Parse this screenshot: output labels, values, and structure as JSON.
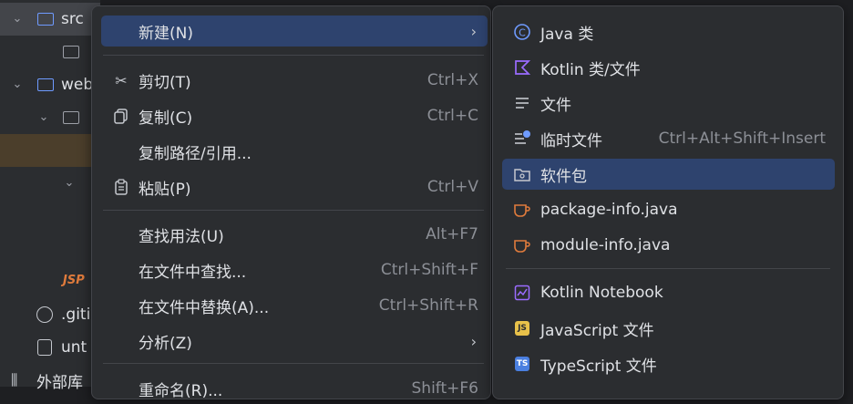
{
  "tree": {
    "items": [
      {
        "label": "src"
      },
      {
        "label": ""
      },
      {
        "label": "web"
      },
      {
        "label": ""
      },
      {
        "label": ".giti"
      },
      {
        "label": "unt"
      },
      {
        "label": "外部库"
      }
    ],
    "jsp_badge": "JSP"
  },
  "menu_main": {
    "items": [
      {
        "label": "新建(N)",
        "shortcut": "",
        "submenu": true
      },
      {
        "label": "剪切(T)",
        "shortcut": "Ctrl+X"
      },
      {
        "label": "复制(C)",
        "shortcut": "Ctrl+C"
      },
      {
        "label": "复制路径/引用...",
        "shortcut": ""
      },
      {
        "label": "粘贴(P)",
        "shortcut": "Ctrl+V"
      },
      {
        "label": "查找用法(U)",
        "shortcut": "Alt+F7"
      },
      {
        "label": "在文件中查找...",
        "shortcut": "Ctrl+Shift+F"
      },
      {
        "label": "在文件中替换(A)...",
        "shortcut": "Ctrl+Shift+R"
      },
      {
        "label": "分析(Z)",
        "shortcut": "",
        "submenu": true
      },
      {
        "label": "重命名(R)...",
        "shortcut": "Shift+F6"
      }
    ]
  },
  "menu_new": {
    "items": [
      {
        "label": "Java 类",
        "shortcut": ""
      },
      {
        "label": "Kotlin 类/文件",
        "shortcut": ""
      },
      {
        "label": "文件",
        "shortcut": ""
      },
      {
        "label": "临时文件",
        "shortcut": "Ctrl+Alt+Shift+Insert"
      },
      {
        "label": "软件包",
        "shortcut": ""
      },
      {
        "label": "package-info.java",
        "shortcut": ""
      },
      {
        "label": "module-info.java",
        "shortcut": ""
      },
      {
        "label": "Kotlin Notebook",
        "shortcut": ""
      },
      {
        "label": "JavaScript 文件",
        "shortcut": ""
      },
      {
        "label": "TypeScript 文件",
        "shortcut": ""
      }
    ]
  },
  "badges": {
    "js": "JS",
    "ts": "TS"
  },
  "colors": {
    "highlight": "#2e436e",
    "accent_blue": "#6f9bff",
    "kotlin_purple": "#9b6cff",
    "java_orange": "#e07b3c"
  }
}
